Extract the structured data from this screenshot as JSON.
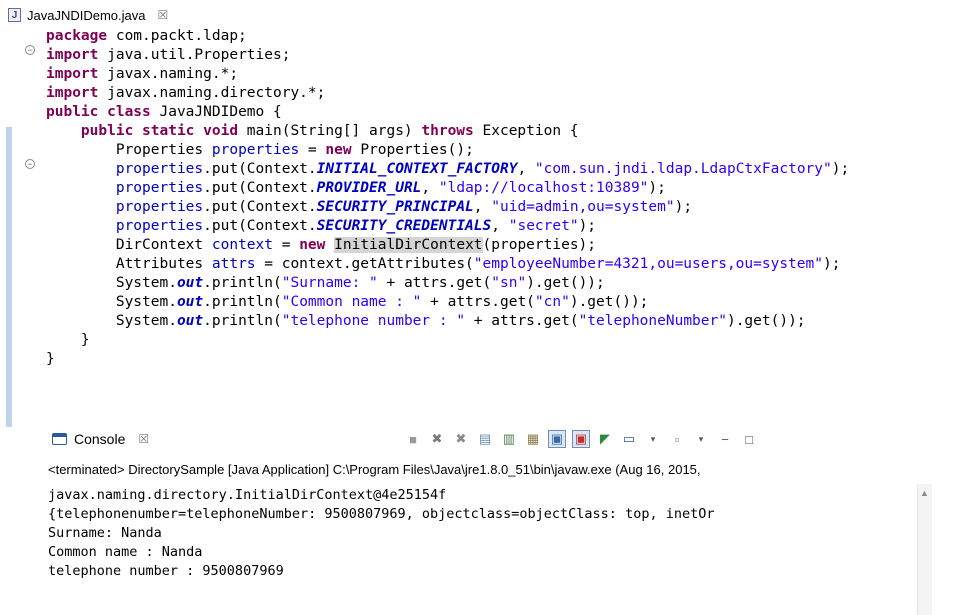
{
  "editor": {
    "tab_label": "JavaJNDIDemo.java",
    "tab_close": "☒",
    "file_icon": "J",
    "lines": [
      [
        {
          "t": "package",
          "c": "kw"
        },
        {
          "t": " com.packt.ldap;"
        }
      ],
      [
        {
          "t": "import",
          "c": "kw"
        },
        {
          "t": " java.util.Properties;"
        }
      ],
      [
        {
          "t": "import",
          "c": "kw"
        },
        {
          "t": " javax.naming.*;"
        }
      ],
      [
        {
          "t": "import",
          "c": "kw"
        },
        {
          "t": " javax.naming.directory.*;"
        }
      ],
      [
        {
          "t": "public class",
          "c": "kw"
        },
        {
          "t": " JavaJNDIDemo {"
        }
      ],
      [
        {
          "t": "    "
        },
        {
          "t": "public static void",
          "c": "kw"
        },
        {
          "t": " main(String[] args) "
        },
        {
          "t": "throws",
          "c": "kw"
        },
        {
          "t": " Exception {"
        }
      ],
      [
        {
          "t": "        Properties "
        },
        {
          "t": "properties",
          "c": "fld"
        },
        {
          "t": " = "
        },
        {
          "t": "new",
          "c": "kw"
        },
        {
          "t": " Properties();"
        }
      ],
      [
        {
          "t": "        "
        },
        {
          "t": "properties",
          "c": "fld"
        },
        {
          "t": ".put(Context."
        },
        {
          "t": "INITIAL_CONTEXT_FACTORY",
          "c": "sfld"
        },
        {
          "t": ", "
        },
        {
          "t": "\"com.sun.jndi.ldap.LdapCtxFactory\"",
          "c": "str"
        },
        {
          "t": ");"
        }
      ],
      [
        {
          "t": "        "
        },
        {
          "t": "properties",
          "c": "fld"
        },
        {
          "t": ".put(Context."
        },
        {
          "t": "PROVIDER_URL",
          "c": "sfld"
        },
        {
          "t": ", "
        },
        {
          "t": "\"ldap://localhost:10389\"",
          "c": "str"
        },
        {
          "t": ");"
        }
      ],
      [
        {
          "t": "        "
        },
        {
          "t": "properties",
          "c": "fld"
        },
        {
          "t": ".put(Context."
        },
        {
          "t": "SECURITY_PRINCIPAL",
          "c": "sfld"
        },
        {
          "t": ", "
        },
        {
          "t": "\"uid=admin,ou=system\"",
          "c": "str"
        },
        {
          "t": ");"
        }
      ],
      [
        {
          "t": "        "
        },
        {
          "t": "properties",
          "c": "fld"
        },
        {
          "t": ".put(Context."
        },
        {
          "t": "SECURITY_CREDENTIALS",
          "c": "sfld"
        },
        {
          "t": ", "
        },
        {
          "t": "\"secret\"",
          "c": "str"
        },
        {
          "t": ");"
        }
      ],
      [
        {
          "t": "        DirContext "
        },
        {
          "t": "context",
          "c": "fld"
        },
        {
          "t": " = "
        },
        {
          "t": "new",
          "c": "kw"
        },
        {
          "t": " "
        },
        {
          "t": "InitialDirContext",
          "c": "hl"
        },
        {
          "t": "(properties);"
        }
      ],
      [
        {
          "t": "        Attributes "
        },
        {
          "t": "attrs",
          "c": "fld"
        },
        {
          "t": " = context.getAttributes("
        },
        {
          "t": "\"employeeNumber=4321,ou=users,ou=system\"",
          "c": "str"
        },
        {
          "t": ");"
        }
      ],
      [
        {
          "t": "        System."
        },
        {
          "t": "out",
          "c": "sfld"
        },
        {
          "t": ".println("
        },
        {
          "t": "\"Surname: \"",
          "c": "str"
        },
        {
          "t": " + attrs.get("
        },
        {
          "t": "\"sn\"",
          "c": "str"
        },
        {
          "t": ").get());"
        }
      ],
      [
        {
          "t": "        System."
        },
        {
          "t": "out",
          "c": "sfld"
        },
        {
          "t": ".println("
        },
        {
          "t": "\"Common name : \"",
          "c": "str"
        },
        {
          "t": " + attrs.get("
        },
        {
          "t": "\"cn\"",
          "c": "str"
        },
        {
          "t": ").get());"
        }
      ],
      [
        {
          "t": "        System."
        },
        {
          "t": "out",
          "c": "sfld"
        },
        {
          "t": ".println("
        },
        {
          "t": "\"telephone number : \"",
          "c": "str"
        },
        {
          "t": " + attrs.get("
        },
        {
          "t": "\"telephoneNumber\"",
          "c": "str"
        },
        {
          "t": ").get());"
        }
      ],
      [
        {
          "t": "    }"
        }
      ],
      [
        {
          "t": "}"
        }
      ]
    ]
  },
  "console": {
    "title": "Console",
    "close": "☒",
    "status": "<terminated> DirectorySample [Java Application] C:\\Program Files\\Java\\jre1.8.0_51\\bin\\javaw.exe (Aug 16, 2015,",
    "output": [
      "javax.naming.directory.InitialDirContext@4e25154f",
      "{telephonenumber=telephoneNumber: 9500807969, objectclass=objectClass: top, inetOr",
      "Surname: Nanda",
      "Common name : Nanda",
      "telephone number : 9500807969"
    ],
    "toolbar_icons": [
      "terminate-icon",
      "remove-launch-icon",
      "remove-all-terminated-icon",
      "clear-console-icon",
      "scroll-lock-icon",
      "word-wrap-icon",
      "show-on-stdout-icon",
      "show-on-stderr-icon",
      "pin-console-icon",
      "display-console-icon",
      "open-console-icon",
      "minimize-icon",
      "maximize-icon"
    ],
    "colors": {
      "keyword": "#7f0055",
      "string": "#2a00ff",
      "field": "#0000c0"
    }
  }
}
